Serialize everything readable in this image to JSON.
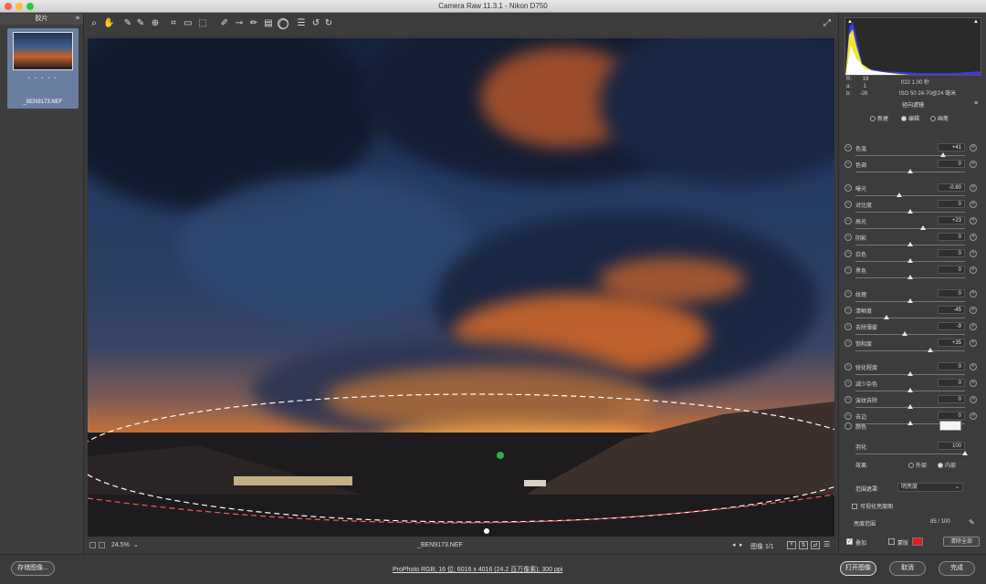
{
  "window": {
    "title": "Camera Raw 11.3.1 - Nikon D750"
  },
  "filmstrip": {
    "header": "胶片",
    "filename": "_BEN9173.NEF",
    "stars": "• • • • •"
  },
  "image": {
    "zoom": "24.5%",
    "filename": "_BEN9173.NEF",
    "image_counter": "图像 1/1"
  },
  "histogram": {
    "r_label": "R:",
    "r": "19",
    "g_label": "a:",
    "g": "1",
    "b_label": "b:",
    "b": "-26",
    "aperture_shutter": "f/22   1.00 秒",
    "iso_lens": "ISO 50   24-70@24 毫米"
  },
  "panel": {
    "title": "径向滤镜",
    "modes": [
      "新建",
      "编辑",
      "画笔"
    ],
    "selected_mode": 1,
    "sliders": [
      {
        "label": "色温",
        "value": "+41",
        "pos": 0.8
      },
      {
        "label": "色调",
        "value": "0",
        "pos": 0.5
      },
      {
        "label": "曝光",
        "value": "-0.80",
        "pos": 0.4
      },
      {
        "label": "对比度",
        "value": "0",
        "pos": 0.5
      },
      {
        "label": "高光",
        "value": "+23",
        "pos": 0.62
      },
      {
        "label": "阴影",
        "value": "0",
        "pos": 0.5
      },
      {
        "label": "白色",
        "value": "0",
        "pos": 0.5
      },
      {
        "label": "黑色",
        "value": "0",
        "pos": 0.5
      },
      {
        "label": "纹理",
        "value": "0",
        "pos": 0.5
      },
      {
        "label": "清晰度",
        "value": "-45",
        "pos": 0.28
      },
      {
        "label": "去除薄雾",
        "value": "-9",
        "pos": 0.45
      },
      {
        "label": "饱和度",
        "value": "+35",
        "pos": 0.68
      },
      {
        "label": "锐化程度",
        "value": "0",
        "pos": 0.5
      },
      {
        "label": "减少杂色",
        "value": "0",
        "pos": 0.5
      },
      {
        "label": "波纹去除",
        "value": "0",
        "pos": 0.5
      },
      {
        "label": "去边",
        "value": "0",
        "pos": 0.5
      }
    ],
    "color_label": "颜色",
    "feather_label": "羽化",
    "feather_value": "100",
    "effect_label": "效果:",
    "effect_outside": "外部",
    "effect_inside": "内部",
    "range_mask_label": "范围遮罩:",
    "range_mask_value": "明亮度",
    "show_luminance": "可视化亮度图",
    "luminance_range_label": "亮度范围",
    "luminance_range_value": "85 / 100",
    "overlay_label": "叠加",
    "mask_label": "蒙版",
    "clear_all": "清除全部"
  },
  "footer": {
    "save_button": "存储图像...",
    "workflow_link": "ProPhoto RGB; 16 位; 6016 x 4016 (24.2 百万像素); 300 ppi",
    "open_button": "打开图像",
    "cancel_button": "取消",
    "done_button": "完成"
  },
  "colors": {
    "accent_green": "#2bb14a",
    "mask_red": "#e21b1b",
    "histogram_yellow": "#f1e630",
    "histogram_blue": "#3a3ae6"
  },
  "icons": [
    "zoom-icon",
    "hand-icon",
    "white-balance-icon",
    "color-sampler-icon",
    "targeted-adjust-icon",
    "crop-icon",
    "straighten-icon",
    "transform-icon",
    "spot-removal-icon",
    "red-eye-icon",
    "adjustment-brush-icon",
    "graduated-filter-icon",
    "radial-filter-icon",
    "preferences-icon",
    "rotate-left-icon",
    "rotate-right-icon"
  ]
}
